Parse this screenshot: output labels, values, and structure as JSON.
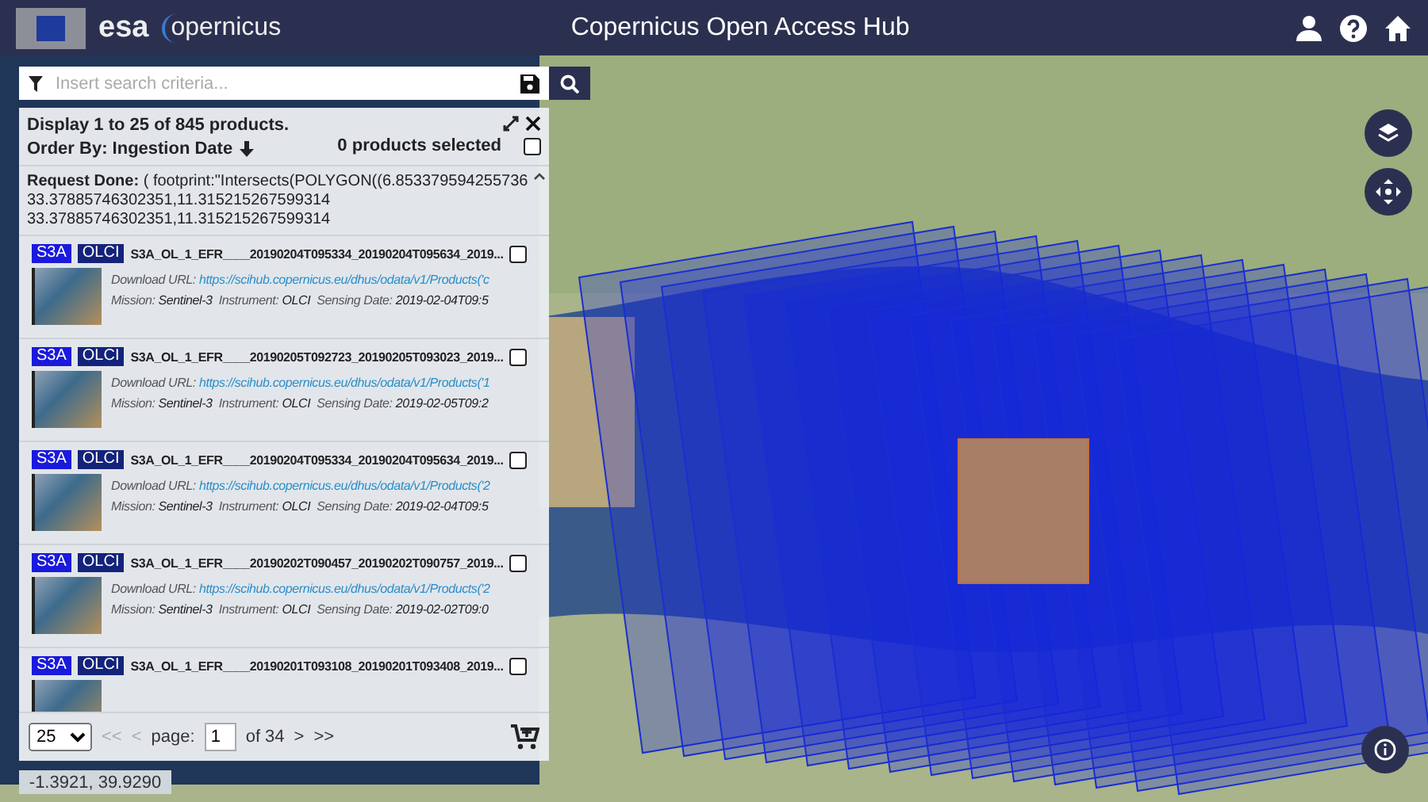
{
  "header": {
    "title": "Copernicus Open Access Hub",
    "logos": [
      "esa",
      "opernicus"
    ]
  },
  "search": {
    "placeholder": "Insert search criteria..."
  },
  "results": {
    "summary": "Display 1 to 25 of 845 products.",
    "order_by": "Order By: Ingestion Date",
    "selected_count": "0 products selected",
    "select_all_checked": false,
    "request": {
      "label": "Request Done:",
      "lines": [
        "( footprint:\"Intersects(POLYGON((6.853379594255736",
        "33.37885746302351,11.315215267599314",
        "33.37885746302351,11.315215267599314"
      ]
    },
    "products": [
      {
        "mission_badge": "S3A",
        "instrument_badge": "OLCI",
        "title": "S3A_OL_1_EFR____20190204T095334_20190204T095634_2019...",
        "checked": false,
        "url_label": "Download URL:",
        "url": "https://scihub.copernicus.eu/dhus/odata/v1/Products('c",
        "mission_label": "Mission:",
        "mission": "Sentinel-3",
        "instrument_label": "Instrument:",
        "instrument": "OLCI",
        "date_label": "Sensing Date:",
        "date": "2019-02-04T09:5"
      },
      {
        "mission_badge": "S3A",
        "instrument_badge": "OLCI",
        "title": "S3A_OL_1_EFR____20190205T092723_20190205T093023_2019...",
        "checked": false,
        "url_label": "Download URL:",
        "url": "https://scihub.copernicus.eu/dhus/odata/v1/Products('1",
        "mission_label": "Mission:",
        "mission": "Sentinel-3",
        "instrument_label": "Instrument:",
        "instrument": "OLCI",
        "date_label": "Sensing Date:",
        "date": "2019-02-05T09:2"
      },
      {
        "mission_badge": "S3A",
        "instrument_badge": "OLCI",
        "title": "S3A_OL_1_EFR____20190204T095334_20190204T095634_2019...",
        "checked": false,
        "url_label": "Download URL:",
        "url": "https://scihub.copernicus.eu/dhus/odata/v1/Products('2",
        "mission_label": "Mission:",
        "mission": "Sentinel-3",
        "instrument_label": "Instrument:",
        "instrument": "OLCI",
        "date_label": "Sensing Date:",
        "date": "2019-02-04T09:5"
      },
      {
        "mission_badge": "S3A",
        "instrument_badge": "OLCI",
        "title": "S3A_OL_1_EFR____20190202T090457_20190202T090757_2019...",
        "checked": false,
        "url_label": "Download URL:",
        "url": "https://scihub.copernicus.eu/dhus/odata/v1/Products('2",
        "mission_label": "Mission:",
        "mission": "Sentinel-3",
        "instrument_label": "Instrument:",
        "instrument": "OLCI",
        "date_label": "Sensing Date:",
        "date": "2019-02-02T09:0"
      },
      {
        "mission_badge": "S3A",
        "instrument_badge": "OLCI",
        "title": "S3A_OL_1_EFR____20190201T093108_20190201T093408_2019...",
        "checked": false
      }
    ],
    "pager": {
      "page_size": "25",
      "first": "<<",
      "prev": "<",
      "page_label": "page:",
      "page": "1",
      "of": "of 34",
      "next": ">",
      "last": ">>"
    }
  },
  "coordinates": "-1.3921, 39.9290"
}
